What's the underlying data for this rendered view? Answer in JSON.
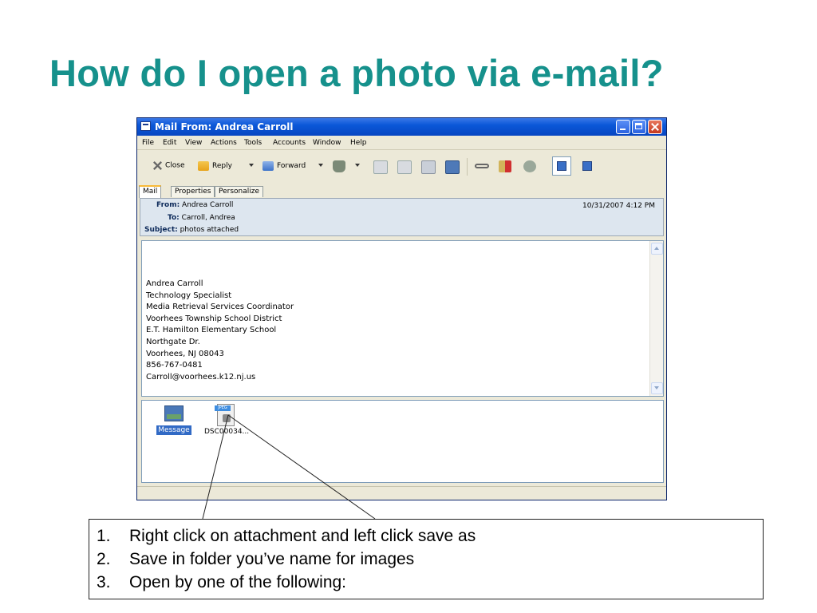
{
  "slide": {
    "title": "How do I open a photo via e-mail?",
    "title_color": "#16918c"
  },
  "window": {
    "title": "Mail From: Andrea Carroll",
    "menu": [
      "File",
      "Edit",
      "View",
      "Actions",
      "Tools",
      "Accounts",
      "Window",
      "Help"
    ],
    "toolbar": {
      "close_label": "Close",
      "reply_label": "Reply",
      "forward_label": "Forward",
      "icons": [
        "trash-icon",
        "envelope-next-icon",
        "envelope-prev-icon",
        "print-icon",
        "save-icon",
        "glasses-icon",
        "attach-icon",
        "globe-icon",
        "view-toggle-icon",
        "preview-toggle-icon"
      ]
    },
    "tabs": [
      "Mail",
      "Properties",
      "Personalize"
    ],
    "header": {
      "from_label": "From:",
      "from_value": "Andrea Carroll",
      "to_label": "To:",
      "to_value": "Carroll, Andrea",
      "subject_label": "Subject:",
      "subject_value": "photos attached",
      "date": "10/31/2007 4:12 PM"
    },
    "body_signature": [
      "Andrea Carroll",
      "Technology Specialist",
      "Media Retrieval Services Coordinator",
      "Voorhees Township School District",
      "E.T. Hamilton Elementary School",
      "Northgate Dr.",
      "Voorhees, NJ 08043",
      "856-767-0481",
      "Carroll@voorhees.k12.nj.us"
    ],
    "attachments": [
      {
        "label": "Message",
        "icon": "message-icon",
        "selected": true
      },
      {
        "label": "DSC00034...",
        "icon": "jpeg-file-icon",
        "tag": "JPEG",
        "selected": false
      }
    ]
  },
  "instructions": [
    {
      "num": "1.",
      "text": "Right click on attachment and left click save as"
    },
    {
      "num": "2.",
      "text": "Save in folder you’ve name for images"
    },
    {
      "num": "3.",
      "text": "Open by one of the following:"
    }
  ]
}
